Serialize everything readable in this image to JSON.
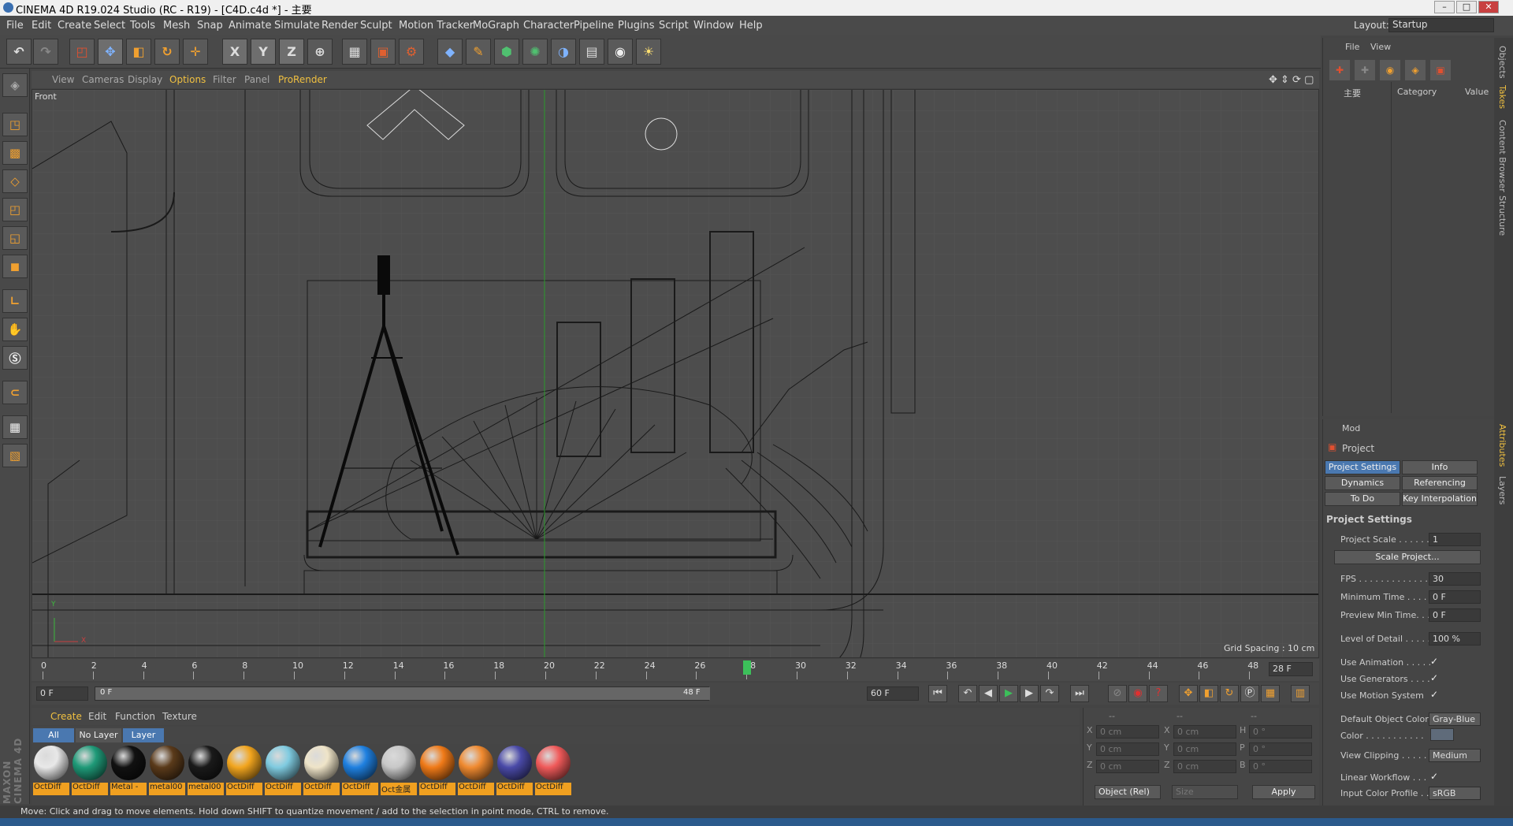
{
  "window": {
    "title": "CINEMA 4D R19.024 Studio (RC - R19) - [C4D.c4d *] - 主要",
    "layout_label": "Layout:",
    "layout_value": "Startup"
  },
  "menubar": [
    "File",
    "Edit",
    "Create",
    "Select",
    "Tools",
    "Mesh",
    "Snap",
    "Animate",
    "Simulate",
    "Render",
    "Sculpt",
    "Motion Tracker",
    "MoGraph",
    "Character",
    "Pipeline",
    "Plugins",
    "Script",
    "Window",
    "Help"
  ],
  "toolbar": {
    "icons": [
      "undo-icon",
      "redo-icon",
      "live-selection-icon",
      "move-icon",
      "scale-icon",
      "rotate-icon",
      "move-all-icon",
      "x-axis-icon",
      "y-axis-icon",
      "z-axis-icon",
      "world-coord-icon",
      "render-view-icon",
      "render-picture-queue-icon",
      "render-settings-icon",
      "cube-icon",
      "pen-icon",
      "subdivision-icon",
      "cloner-icon",
      "deformer-icon",
      "floor-icon",
      "camera-icon",
      "light-icon"
    ],
    "axis_x": "X",
    "axis_y": "Y",
    "axis_z": "Z"
  },
  "viewport": {
    "menu": [
      "View",
      "Cameras",
      "Display",
      "Options",
      "Filter",
      "Panel",
      "ProRender"
    ],
    "view_name": "Front",
    "grid_spacing": "Grid Spacing : 10 cm",
    "axis_y": "Y",
    "axis_x": "X"
  },
  "timeline": {
    "ticks": [
      "0",
      "2",
      "4",
      "6",
      "8",
      "10",
      "12",
      "14",
      "16",
      "18",
      "20",
      "22",
      "24",
      "26",
      "28",
      "30",
      "32",
      "34",
      "36",
      "38",
      "40",
      "42",
      "44",
      "46",
      "48"
    ],
    "current_frame_field": "28 F",
    "current_frame": 28,
    "start_field": "0 F",
    "range_start": "0 F",
    "range_end": "48 F",
    "end_field": "60 F"
  },
  "material_manager": {
    "menu": [
      "Create",
      "Edit",
      "Function",
      "Texture"
    ],
    "filters": [
      "All",
      "No Layer",
      "Layer"
    ],
    "materials": [
      {
        "label": "OctDiff",
        "color": "#e8e8e8"
      },
      {
        "label": "OctDiff",
        "color": "#1f9a78"
      },
      {
        "label": "Metal -",
        "color": "#111111"
      },
      {
        "label": "metal00",
        "color": "#5a3a1a"
      },
      {
        "label": "metal00",
        "color": "#1a1a1a"
      },
      {
        "label": "OctDiff",
        "color": "#f2a51e"
      },
      {
        "label": "OctDiff",
        "color": "#7fcbe0"
      },
      {
        "label": "OctDiff",
        "color": "#efe4c8"
      },
      {
        "label": "OctDiff",
        "color": "#1f80e0"
      },
      {
        "label": "Oct金属",
        "color": "#c8c8c8"
      },
      {
        "label": "OctDiff",
        "color": "#f07a18"
      },
      {
        "label": "OctDiff",
        "color": "#f08a30"
      },
      {
        "label": "OctDiff",
        "color": "#4a4aa8"
      },
      {
        "label": "OctDiff",
        "color": "#f05a5a"
      }
    ]
  },
  "coords": {
    "headers": [
      "--",
      "--",
      "--"
    ],
    "rows": [
      {
        "a": "X",
        "av": "0 cm",
        "b": "X",
        "bv": "0 cm",
        "c": "H",
        "cv": "0 °"
      },
      {
        "a": "Y",
        "av": "0 cm",
        "b": "Y",
        "bv": "0 cm",
        "c": "P",
        "cv": "0 °"
      },
      {
        "a": "Z",
        "av": "0 cm",
        "b": "Z",
        "bv": "0 cm",
        "c": "B",
        "cv": "0 °"
      }
    ],
    "mode": "Object (Rel)",
    "size": "Size",
    "apply": "Apply"
  },
  "object_manager": {
    "menu": [
      "File",
      "View"
    ],
    "col_name": "主要",
    "col_category": "Category",
    "col_value": "Value"
  },
  "attributes": {
    "mode": "Mod",
    "title": "Project",
    "tabs": [
      "Project Settings",
      "Info",
      "Dynamics",
      "Referencing",
      "To Do",
      "Key Interpolation"
    ],
    "section": "Project Settings",
    "project_scale_label": "Project Scale . . . . . .",
    "project_scale": "1",
    "scale_project": "Scale Project...",
    "fps_label": "FPS . . . . . . . . . . . . . .",
    "fps": "30",
    "min_time_label": "Minimum Time . . . . .",
    "min_time": "0 F",
    "preview_min_label": "Preview Min Time. . .",
    "preview_min": "0 F",
    "lod_label": "Level of Detail . . . . .",
    "lod": "100 %",
    "use_animation": "Use Animation . . . . .",
    "use_generators": "Use Generators . . . .",
    "use_motion": "Use Motion System",
    "default_color_label": "Default Object Color",
    "default_color": "Gray-Blue",
    "color_label": "Color . . . . . . . . . . .",
    "view_clipping_label": "View Clipping . . . . . .",
    "view_clipping": "Medium",
    "linear_workflow": "Linear Workflow . . .",
    "input_profile_label": "Input Color Profile . .",
    "input_profile": "sRGB",
    "check": "✓"
  },
  "side_tabs": [
    "Objects",
    "Takes",
    "Content Browser",
    "Structure",
    "Attributes",
    "Layers"
  ],
  "status": "Move: Click and drag to move elements. Hold down SHIFT to quantize movement / add to the selection in point mode, CTRL to remove.",
  "brand": "MAXON CINEMA 4D"
}
